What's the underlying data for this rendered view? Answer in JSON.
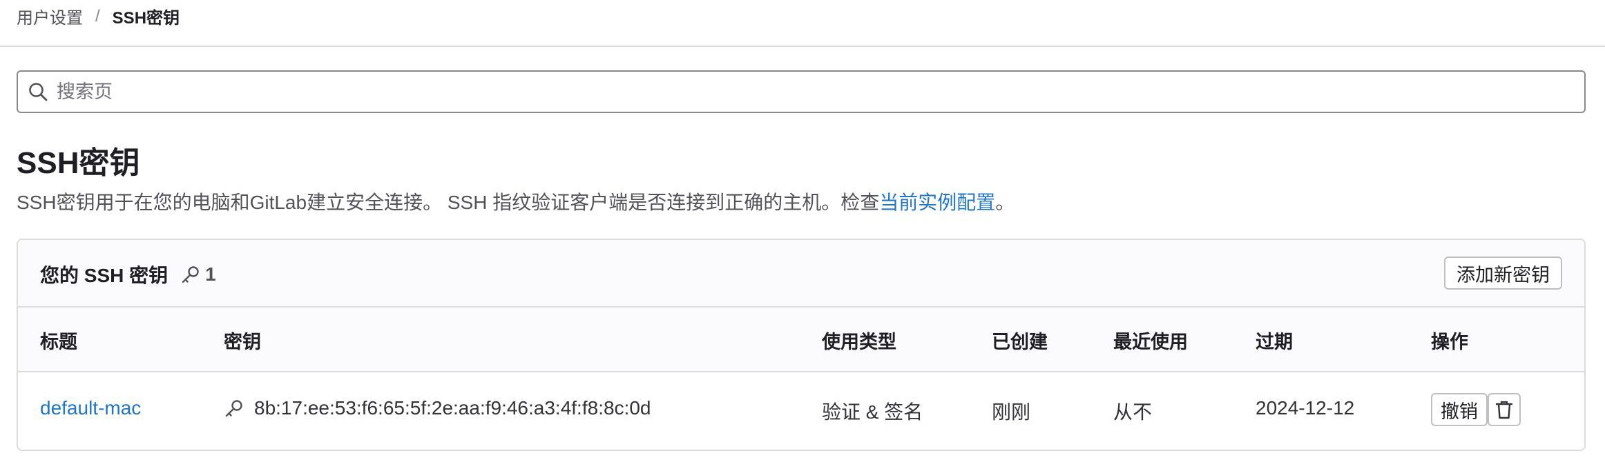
{
  "breadcrumb": {
    "parent": "用户设置",
    "separator": "/",
    "current": "SSH密钥"
  },
  "search": {
    "placeholder": "搜索页",
    "value": "",
    "icon": "search-icon"
  },
  "page": {
    "title": "SSH密钥",
    "description_text": "SSH密钥用于在您的电脑和GitLab建立安全连接。 SSH 指纹验证客户端是否连接到正确的主机。检查",
    "description_link": "当前实例配置",
    "description_end": "。"
  },
  "keys_card": {
    "title": "您的 SSH 密钥",
    "count": "1",
    "count_icon": "key-icon",
    "add_button": "添加新密钥",
    "columns": [
      "标题",
      "密钥",
      "使用类型",
      "已创建",
      "最近使用",
      "过期",
      "操作"
    ],
    "rows": [
      {
        "title": "default-mac",
        "fingerprint": "8b:17:ee:53:f6:65:5f:2e:aa:f9:46:a3:4f:f8:8c:0d",
        "usage_type": "验证 & 签名",
        "created": "刚刚",
        "last_used": "从不",
        "expires": "2024-12-12",
        "revoke_label": "撤销",
        "delete_icon": "trash-icon"
      }
    ]
  },
  "colors": {
    "link": "#1f75cb",
    "border": "#dcdcde",
    "header_bg": "#fbfafd",
    "text": "#333238"
  }
}
